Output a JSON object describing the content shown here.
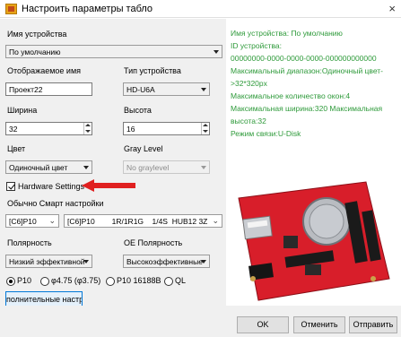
{
  "window": {
    "title": "Настроить параметры табло",
    "close_glyph": "×"
  },
  "form": {
    "device_name": {
      "label": "Имя устройства",
      "value": "По умолчанию"
    },
    "display_name": {
      "label": "Отображаемое имя",
      "value": "Проект22"
    },
    "device_type": {
      "label": "Тип устройства",
      "value": "HD-U6A"
    },
    "width": {
      "label": "Ширина",
      "value": "32"
    },
    "height": {
      "label": "Высота",
      "value": "16"
    },
    "color": {
      "label": "Цвет",
      "value": "Одиночный цвет"
    },
    "gray_level": {
      "label": "Gray Level",
      "value": "No graylevel"
    },
    "hardware_settings": {
      "label": "Hardware Settings",
      "checked": true
    },
    "smart_settings": {
      "label": "Обычно Смарт настройки",
      "preset": "[C6]P10",
      "detail": "[C6]P10        1R/1R1G    1/4S  HUB12 3Z"
    },
    "polarity": {
      "label": "Полярность",
      "value": "Низкий эффективной"
    },
    "oe_polarity": {
      "label": "OE Полярность",
      "value": "Высокоэффективные"
    },
    "pitch_options": [
      {
        "label": "P10",
        "selected": true
      },
      {
        "label": "φ4.75 (φ3.75)",
        "selected": false
      },
      {
        "label": "P10 16188B",
        "selected": false
      },
      {
        "label": "QL",
        "selected": false
      }
    ],
    "advanced_button": "полнительные настрой"
  },
  "info": {
    "lines": [
      "Имя устройства: По умолчанию",
      "ID устройства:",
      "00000000-0000-0000-0000-000000000000",
      "Максимальный диапазон:Одиночный цвет-",
      ">32*320px",
      "Максимальное количество окон:4",
      "Максимальная ширина:320 Максимальная",
      "высота:32",
      "Режим связи:U-Disk"
    ]
  },
  "board_image": {
    "label": "U6A"
  },
  "buttons": {
    "ok": "OK",
    "cancel": "Отменить",
    "send": "Отправить"
  },
  "colors": {
    "info_text": "#2e9a3a",
    "arrow": "#e02020",
    "board": "#d81e2a"
  }
}
